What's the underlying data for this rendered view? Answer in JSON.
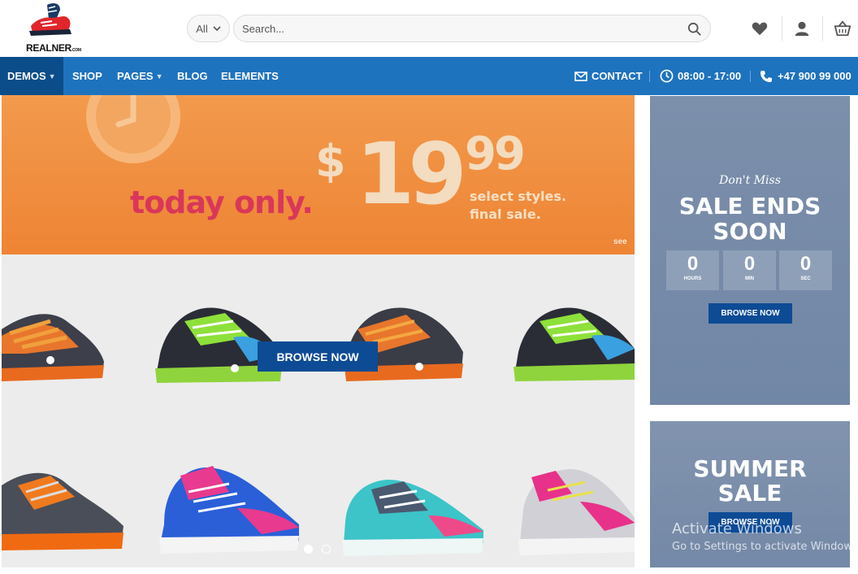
{
  "header": {
    "logo_text": "REALNER",
    "logo_suffix": ".COM",
    "category_select": "All",
    "search_placeholder": "Search..."
  },
  "nav": {
    "items": [
      {
        "label": "DEMOS",
        "has_caret": true,
        "active": true
      },
      {
        "label": "SHOP",
        "has_caret": false
      },
      {
        "label": "PAGES",
        "has_caret": true
      },
      {
        "label": "BLOG",
        "has_caret": false
      },
      {
        "label": "ELEMENTS",
        "has_caret": false
      }
    ],
    "contact_label": "CONTACT",
    "hours": "08:00 - 17:00",
    "phone": "+47 900 99 000"
  },
  "hero": {
    "today_text": "today only.",
    "price_dollar": "$",
    "price_main": "19",
    "price_cents": "99",
    "styles_line1": "select styles.",
    "styles_line2": "final sale.",
    "see_text": "see",
    "browse_button": "BROWSE NOW",
    "slides_total": 2,
    "slide_active": 1
  },
  "side_banner_1": {
    "kicker": "Don't Miss",
    "title_line1": "SALE ENDS",
    "title_line2": "SOON",
    "countdown": [
      {
        "value": "0",
        "unit": "HOURS"
      },
      {
        "value": "0",
        "unit": "MIN"
      },
      {
        "value": "0",
        "unit": "SEC"
      }
    ],
    "button": "BROWSE NOW"
  },
  "side_banner_2": {
    "title_line1": "SUMMER",
    "title_line2": "SALE",
    "button": "BROWSE NOW"
  },
  "watermark": {
    "line1": "Activate Windows",
    "line2": "Go to Settings to activate Windows."
  },
  "colors": {
    "nav_blue": "#1e73be",
    "nav_active": "#0a4d8a",
    "button_blue": "#0d4b95",
    "promo_orange": "#ee8434",
    "promo_pink": "#d9375a"
  }
}
